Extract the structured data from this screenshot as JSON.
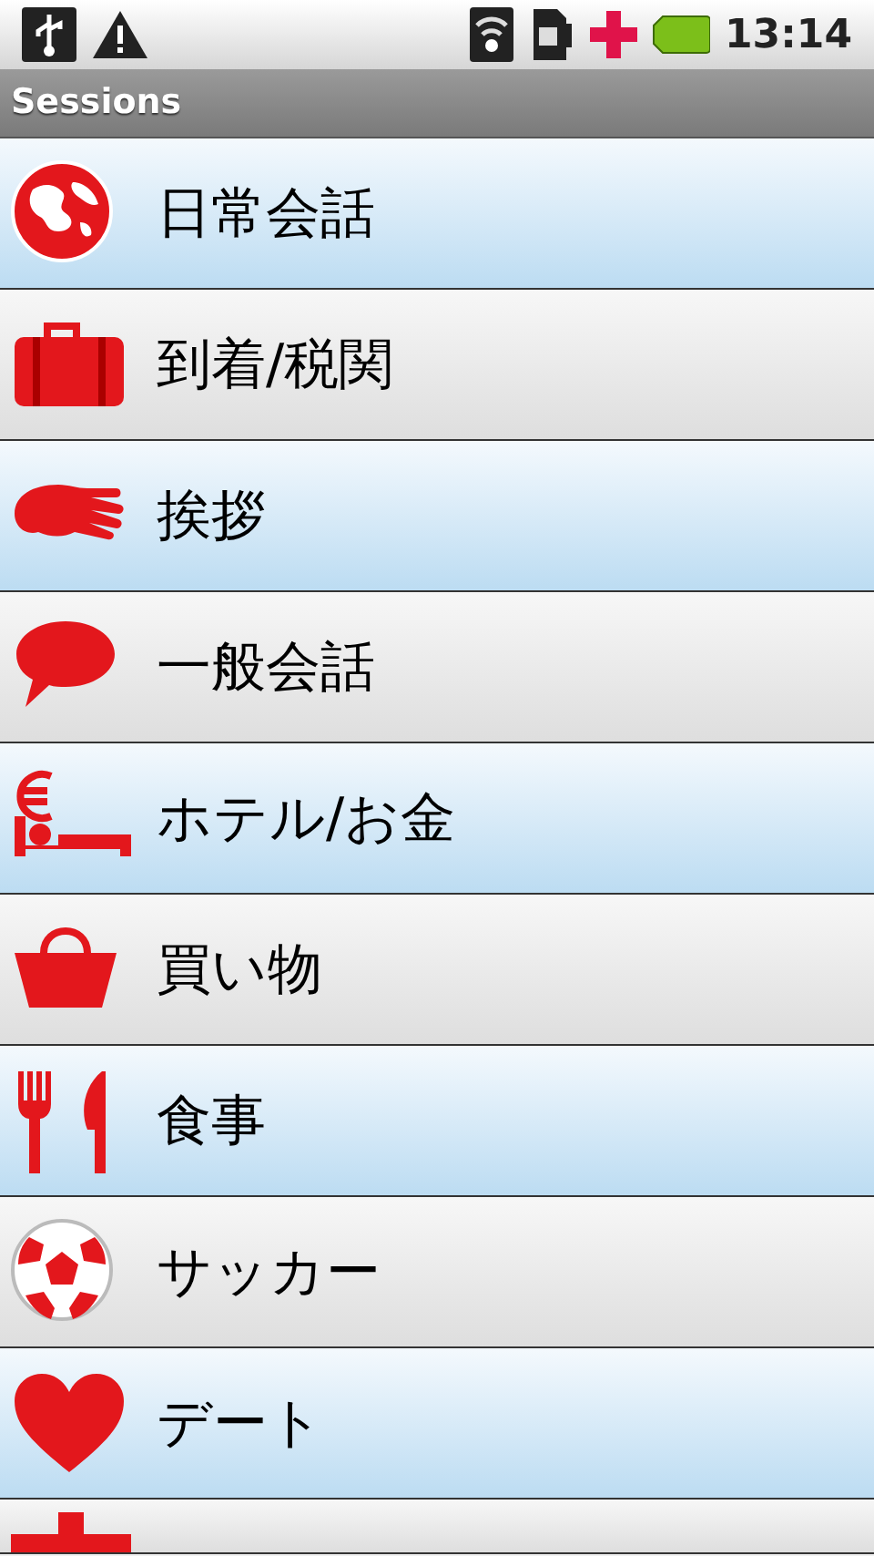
{
  "status_bar": {
    "time": "13:14"
  },
  "title": "Sessions",
  "sessions": [
    {
      "label": "日常会話"
    },
    {
      "label": "到着/税関"
    },
    {
      "label": "挨拶"
    },
    {
      "label": "一般会話"
    },
    {
      "label": "ホテル/お金"
    },
    {
      "label": "買い物"
    },
    {
      "label": "食事"
    },
    {
      "label": "サッカー"
    },
    {
      "label": "デート"
    }
  ]
}
